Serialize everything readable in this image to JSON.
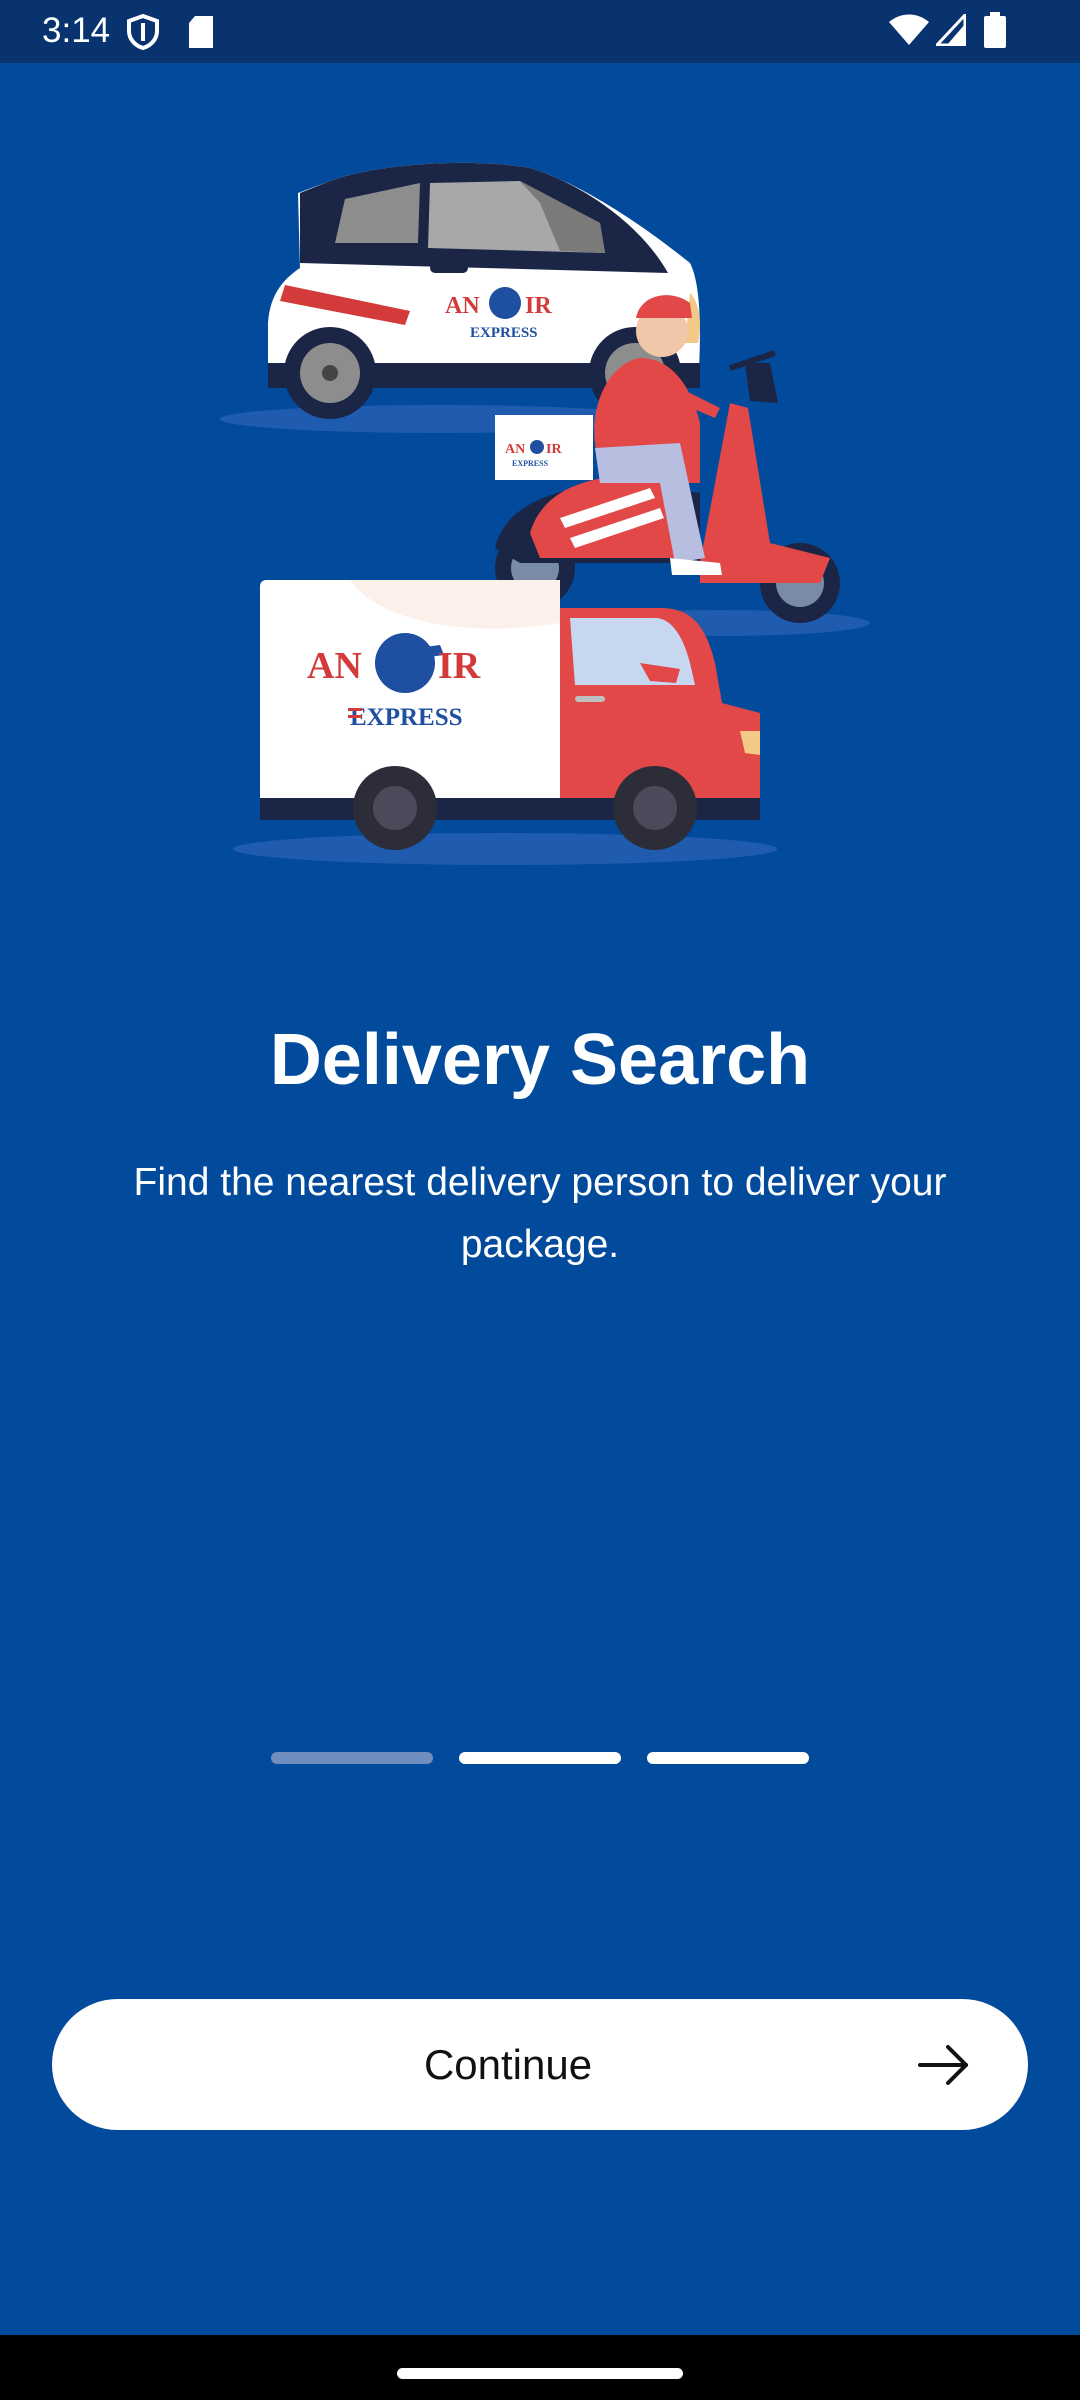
{
  "status_bar": {
    "time": "3:14",
    "icons": [
      "shield-icon",
      "sd-card-icon",
      "wifi-icon",
      "signal-icon",
      "battery-icon"
    ]
  },
  "illustration": {
    "brand_name_left": "AN",
    "brand_name_right": "IR",
    "brand_tagline": "EXPRESS",
    "vehicles": [
      "car",
      "scooter",
      "delivery-truck"
    ]
  },
  "onboarding": {
    "title": "Delivery Search",
    "description": "Find the nearest delivery person to deliver your package.",
    "page_indicator": {
      "total": 3,
      "current": 1
    }
  },
  "continue_button": {
    "label": "Continue",
    "icon": "arrow-right-icon"
  },
  "colors": {
    "background": "#024B9C",
    "status_bar": "#08336F",
    "button": "#FFFFFF",
    "indicator_inactive": "#6F8EBE",
    "indicator_active": "#FFFFFF",
    "brand_red": "#D33A3A",
    "brand_blue": "#1E4FA0"
  }
}
